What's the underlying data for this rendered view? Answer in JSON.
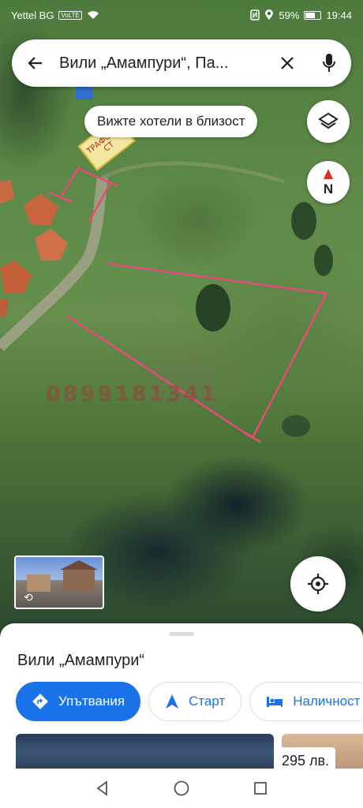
{
  "status_bar": {
    "carrier": "Yettel BG",
    "volte": "VoLTE",
    "battery": "59%",
    "time": "19:44"
  },
  "search": {
    "query": "Вили „Амампури“, Па...",
    "back_icon": "arrow-left-icon",
    "clear_icon": "close-icon",
    "mic_icon": "mic-icon"
  },
  "map": {
    "hotels_chip": "Вижте хотели в близост",
    "compass_label": "N",
    "trafo_label": "ТРАФОПО СТ",
    "watermark": "0899181341",
    "boundary_color": "#e84a7a"
  },
  "sheet": {
    "place_title": "Вили „Амампури“",
    "chips": [
      {
        "label": "Упътвания",
        "icon": "directions-icon",
        "style": "primary"
      },
      {
        "label": "Старт",
        "icon": "navigation-arrow-icon",
        "style": "outline"
      },
      {
        "label": "Наличност",
        "icon": "bed-icon",
        "style": "outline"
      }
    ],
    "price": "295 лв."
  },
  "colors": {
    "accent": "#1a73e8",
    "text": "#202124"
  }
}
